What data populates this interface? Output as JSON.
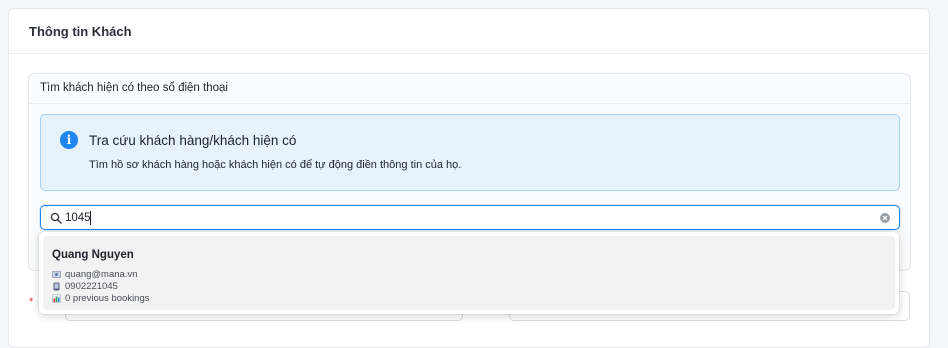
{
  "panel": {
    "title": "Thông tin Khách"
  },
  "search_section": {
    "title": "Tìm khách hiện có theo số điện thoại",
    "info": {
      "icon": "info-icon",
      "title": "Tra cứu khách hàng/khách hiện có",
      "description": "Tìm hồ sơ khách hàng hoặc khách hiện có để tự động điền thông tin của họ."
    },
    "search": {
      "value": "1045",
      "placeholder": ""
    }
  },
  "results": [
    {
      "name": "Quang Nguyen",
      "email": "quang@mana.vn",
      "phone": "0902221045",
      "bookings": "0 previous bookings"
    }
  ],
  "form": {
    "required_mark": "*"
  },
  "colors": {
    "accent": "#1f86f0",
    "info_bg": "#e6f2fc",
    "required": "#e0322f"
  }
}
